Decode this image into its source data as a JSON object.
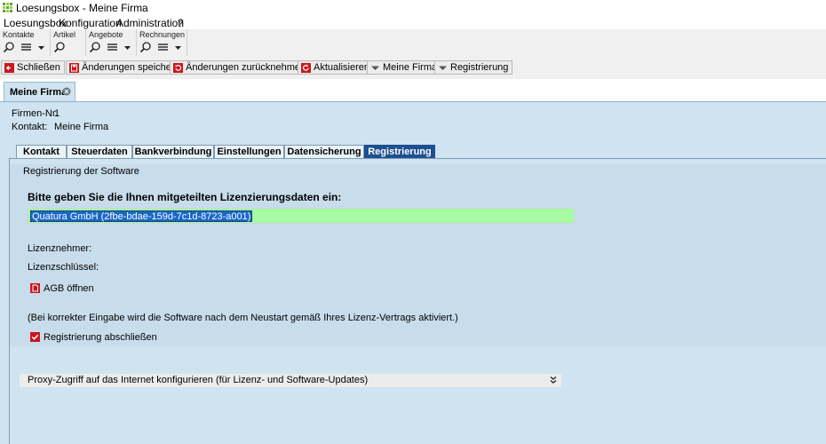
{
  "window": {
    "title": "Loesungsbox - Meine Firma"
  },
  "menu": {
    "items": [
      "Loesungsbox",
      "Konfiguration",
      "Administration",
      "?"
    ]
  },
  "quick_groups": [
    {
      "label": "Kontakte"
    },
    {
      "label": "Artikel"
    },
    {
      "label": "Angebote"
    },
    {
      "label": "Rechnungen"
    }
  ],
  "toolbar": {
    "close": "Schließen",
    "save": "Änderungen speichern",
    "revert": "Änderungen zurücknehmen",
    "refresh": "Aktualisieren",
    "my_company": "Meine Firma",
    "registration": "Registrierung"
  },
  "doc_tab": {
    "label": "Meine Firma"
  },
  "company": {
    "number_label": "Firmen-Nr.",
    "number_value": "1",
    "contact_label": "Kontakt:",
    "contact_value": "Meine Firma"
  },
  "form_tabs": [
    {
      "label": "Kontakt"
    },
    {
      "label": "Steuerdaten"
    },
    {
      "label": "Bankverbindung"
    },
    {
      "label": "Einstellungen"
    },
    {
      "label": "Datensicherung"
    },
    {
      "label": "Registrierung",
      "active": true
    }
  ],
  "registration": {
    "section_title": "Registrierung der Software",
    "heading": "Bitte geben Sie die Ihnen mitgeteilten Lizenzierungsdaten ein:",
    "license_input_value": "Quatura GmbH (2fbe-bdae-159d-7c1d-8723-a001)",
    "licensee_label": "Lizenznehmer:",
    "license_key_label": "Lizenzschlüssel:",
    "agb_link": "AGB öffnen",
    "note": "(Bei korrekter Eingabe wird die Software nach dem Neustart gemäß Ihres Lizenz-Vertrags aktiviert.)",
    "complete_checkbox": "Registrierung abschließen",
    "complete_checked": true
  },
  "proxy": {
    "label": "Proxy-Zugriff auf das Internet konfigurieren (für Lizenz- und Software-Updates)"
  },
  "colors": {
    "content_bg": "#cfe3f0",
    "active_tab": "#1e4f91",
    "input_bg": "#a8fba2",
    "selection": "#1967c8",
    "icon_red": "#c8191e"
  }
}
